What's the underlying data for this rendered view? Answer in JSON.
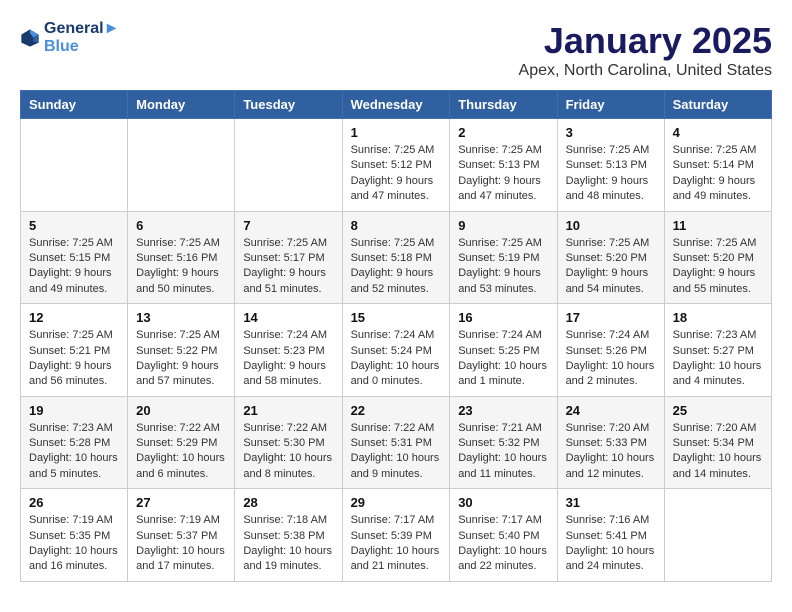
{
  "header": {
    "logo_line1": "General",
    "logo_line2": "Blue",
    "month": "January 2025",
    "location": "Apex, North Carolina, United States"
  },
  "days_of_week": [
    "Sunday",
    "Monday",
    "Tuesday",
    "Wednesday",
    "Thursday",
    "Friday",
    "Saturday"
  ],
  "weeks": [
    [
      {
        "day": "",
        "info": ""
      },
      {
        "day": "",
        "info": ""
      },
      {
        "day": "",
        "info": ""
      },
      {
        "day": "1",
        "info": "Sunrise: 7:25 AM\nSunset: 5:12 PM\nDaylight: 9 hours\nand 47 minutes."
      },
      {
        "day": "2",
        "info": "Sunrise: 7:25 AM\nSunset: 5:13 PM\nDaylight: 9 hours\nand 47 minutes."
      },
      {
        "day": "3",
        "info": "Sunrise: 7:25 AM\nSunset: 5:13 PM\nDaylight: 9 hours\nand 48 minutes."
      },
      {
        "day": "4",
        "info": "Sunrise: 7:25 AM\nSunset: 5:14 PM\nDaylight: 9 hours\nand 49 minutes."
      }
    ],
    [
      {
        "day": "5",
        "info": "Sunrise: 7:25 AM\nSunset: 5:15 PM\nDaylight: 9 hours\nand 49 minutes."
      },
      {
        "day": "6",
        "info": "Sunrise: 7:25 AM\nSunset: 5:16 PM\nDaylight: 9 hours\nand 50 minutes."
      },
      {
        "day": "7",
        "info": "Sunrise: 7:25 AM\nSunset: 5:17 PM\nDaylight: 9 hours\nand 51 minutes."
      },
      {
        "day": "8",
        "info": "Sunrise: 7:25 AM\nSunset: 5:18 PM\nDaylight: 9 hours\nand 52 minutes."
      },
      {
        "day": "9",
        "info": "Sunrise: 7:25 AM\nSunset: 5:19 PM\nDaylight: 9 hours\nand 53 minutes."
      },
      {
        "day": "10",
        "info": "Sunrise: 7:25 AM\nSunset: 5:20 PM\nDaylight: 9 hours\nand 54 minutes."
      },
      {
        "day": "11",
        "info": "Sunrise: 7:25 AM\nSunset: 5:20 PM\nDaylight: 9 hours\nand 55 minutes."
      }
    ],
    [
      {
        "day": "12",
        "info": "Sunrise: 7:25 AM\nSunset: 5:21 PM\nDaylight: 9 hours\nand 56 minutes."
      },
      {
        "day": "13",
        "info": "Sunrise: 7:25 AM\nSunset: 5:22 PM\nDaylight: 9 hours\nand 57 minutes."
      },
      {
        "day": "14",
        "info": "Sunrise: 7:24 AM\nSunset: 5:23 PM\nDaylight: 9 hours\nand 58 minutes."
      },
      {
        "day": "15",
        "info": "Sunrise: 7:24 AM\nSunset: 5:24 PM\nDaylight: 10 hours\nand 0 minutes."
      },
      {
        "day": "16",
        "info": "Sunrise: 7:24 AM\nSunset: 5:25 PM\nDaylight: 10 hours\nand 1 minute."
      },
      {
        "day": "17",
        "info": "Sunrise: 7:24 AM\nSunset: 5:26 PM\nDaylight: 10 hours\nand 2 minutes."
      },
      {
        "day": "18",
        "info": "Sunrise: 7:23 AM\nSunset: 5:27 PM\nDaylight: 10 hours\nand 4 minutes."
      }
    ],
    [
      {
        "day": "19",
        "info": "Sunrise: 7:23 AM\nSunset: 5:28 PM\nDaylight: 10 hours\nand 5 minutes."
      },
      {
        "day": "20",
        "info": "Sunrise: 7:22 AM\nSunset: 5:29 PM\nDaylight: 10 hours\nand 6 minutes."
      },
      {
        "day": "21",
        "info": "Sunrise: 7:22 AM\nSunset: 5:30 PM\nDaylight: 10 hours\nand 8 minutes."
      },
      {
        "day": "22",
        "info": "Sunrise: 7:22 AM\nSunset: 5:31 PM\nDaylight: 10 hours\nand 9 minutes."
      },
      {
        "day": "23",
        "info": "Sunrise: 7:21 AM\nSunset: 5:32 PM\nDaylight: 10 hours\nand 11 minutes."
      },
      {
        "day": "24",
        "info": "Sunrise: 7:20 AM\nSunset: 5:33 PM\nDaylight: 10 hours\nand 12 minutes."
      },
      {
        "day": "25",
        "info": "Sunrise: 7:20 AM\nSunset: 5:34 PM\nDaylight: 10 hours\nand 14 minutes."
      }
    ],
    [
      {
        "day": "26",
        "info": "Sunrise: 7:19 AM\nSunset: 5:35 PM\nDaylight: 10 hours\nand 16 minutes."
      },
      {
        "day": "27",
        "info": "Sunrise: 7:19 AM\nSunset: 5:37 PM\nDaylight: 10 hours\nand 17 minutes."
      },
      {
        "day": "28",
        "info": "Sunrise: 7:18 AM\nSunset: 5:38 PM\nDaylight: 10 hours\nand 19 minutes."
      },
      {
        "day": "29",
        "info": "Sunrise: 7:17 AM\nSunset: 5:39 PM\nDaylight: 10 hours\nand 21 minutes."
      },
      {
        "day": "30",
        "info": "Sunrise: 7:17 AM\nSunset: 5:40 PM\nDaylight: 10 hours\nand 22 minutes."
      },
      {
        "day": "31",
        "info": "Sunrise: 7:16 AM\nSunset: 5:41 PM\nDaylight: 10 hours\nand 24 minutes."
      },
      {
        "day": "",
        "info": ""
      }
    ]
  ]
}
